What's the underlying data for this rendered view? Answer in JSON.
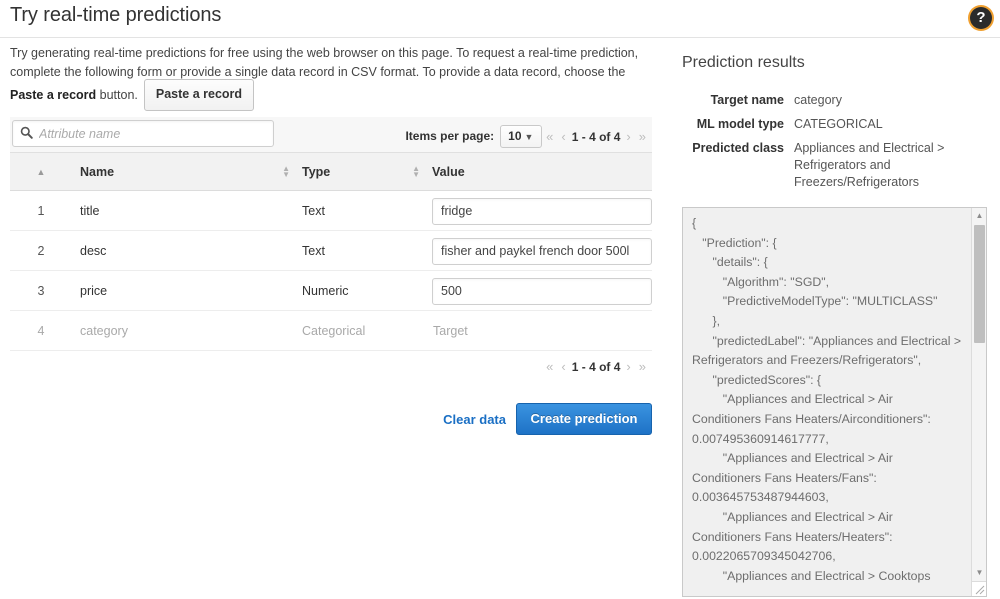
{
  "header": {
    "title": "Try real-time predictions",
    "help_icon": "question-mark-circle-icon"
  },
  "intro": {
    "text_part1": "Try generating real-time predictions for free using the web browser on this page. To request a real-time prediction, complete the following form or provide a single data record in CSV format. To provide a data record, choose the ",
    "bold_phrase": "Paste a record",
    "text_part2": " button.",
    "paste_button_label": "Paste a record"
  },
  "table": {
    "search_placeholder": "Attribute name",
    "search_value": "",
    "items_per_page_label": "Items per page:",
    "items_per_page_value": "10",
    "pager": {
      "first": "«",
      "prev": "‹",
      "range": "1 - 4 of 4",
      "next": "›",
      "last": "»"
    },
    "columns": [
      {
        "key": "index",
        "label": ""
      },
      {
        "key": "name",
        "label": "Name"
      },
      {
        "key": "type",
        "label": "Type"
      },
      {
        "key": "value",
        "label": "Value"
      }
    ],
    "rows": [
      {
        "index": "1",
        "name": "title",
        "type": "Text",
        "value": "fridge",
        "disabled": false
      },
      {
        "index": "2",
        "name": "desc",
        "type": "Text",
        "value": "fisher and paykel french door 500l",
        "disabled": false
      },
      {
        "index": "3",
        "name": "price",
        "type": "Numeric",
        "value": "500",
        "disabled": false
      },
      {
        "index": "4",
        "name": "category",
        "type": "Categorical",
        "value": "Target",
        "disabled": true
      }
    ]
  },
  "actions": {
    "clear_label": "Clear data",
    "create_label": "Create prediction"
  },
  "results": {
    "title": "Prediction results",
    "meta": [
      {
        "label": "Target name",
        "value": "category"
      },
      {
        "label": "ML model type",
        "value": "CATEGORICAL"
      },
      {
        "label": "Predicted class",
        "value": "Appliances and Electrical > Refrigerators and Freezers/Refrigerators"
      }
    ],
    "json_output": "{\n   \"Prediction\": {\n      \"details\": {\n         \"Algorithm\": \"SGD\",\n         \"PredictiveModelType\": \"MULTICLASS\"\n      },\n      \"predictedLabel\": \"Appliances and Electrical > Refrigerators and Freezers/Refrigerators\",\n      \"predictedScores\": {\n         \"Appliances and Electrical > Air Conditioners Fans Heaters/Airconditioners\": 0.007495360914617777,\n         \"Appliances and Electrical > Air Conditioners Fans Heaters/Fans\": 0.003645753487944603,\n         \"Appliances and Electrical > Air Conditioners Fans Heaters/Heaters\": 0.0022065709345042706,\n         \"Appliances and Electrical > Cooktops"
  },
  "colors": {
    "accent_blue": "#1e72c6",
    "link_blue": "#1a6fc4",
    "focus_orange": "#f0a030",
    "panel_gray": "#f0f0f0"
  }
}
